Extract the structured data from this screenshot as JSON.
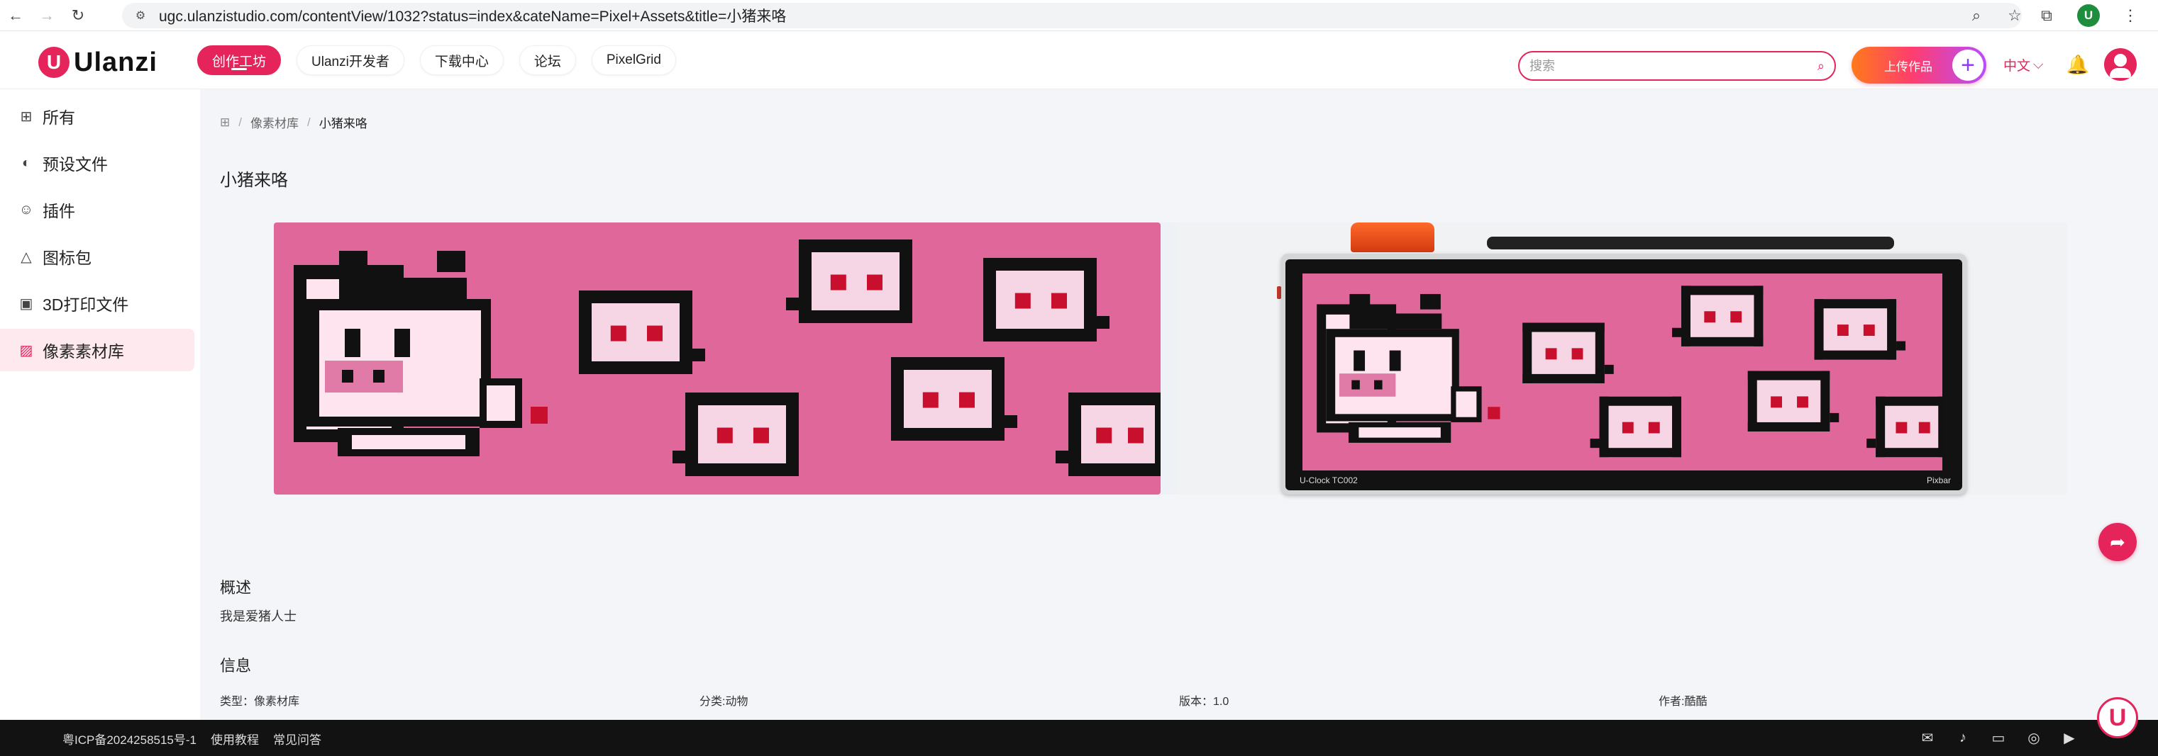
{
  "browser": {
    "url": "ugc.ulanzistudio.com/contentView/1032?status=index&cateName=Pixel+Assets&title=小猪来咯",
    "profile_initial": "U"
  },
  "header": {
    "logo_text": "Ulanzi",
    "nav": [
      "创作工坊",
      "Ulanzi开发者",
      "下载中心",
      "论坛",
      "PixelGrid"
    ],
    "active_nav": "创作工坊",
    "search_placeholder": "搜索",
    "upload_label": "上传作品",
    "upload_plus": "+",
    "language": "中文"
  },
  "sidebar": {
    "items": [
      {
        "label": "所有",
        "icon": "grid-icon"
      },
      {
        "label": "预设文件",
        "icon": "preset-icon"
      },
      {
        "label": "插件",
        "icon": "plugin-icon"
      },
      {
        "label": "图标包",
        "icon": "icon-pack-icon"
      },
      {
        "label": "3D打印文件",
        "icon": "print-3d-icon"
      },
      {
        "label": "像素素材库",
        "icon": "image-icon"
      }
    ],
    "active_index": 5
  },
  "breadcrumb": [
    "像素材库",
    "小猪来咯"
  ],
  "title": "小猪来咯",
  "device": {
    "model": "U-Clock TC002",
    "brand": "Pixbar"
  },
  "overview": {
    "heading": "概述",
    "text": "我是爱猪人士"
  },
  "info": {
    "heading": "信息",
    "type": "类型：像素材库",
    "category": "分类:动物",
    "version": "版本：1.0",
    "author": "作者:酷酷"
  },
  "footer": {
    "icp": "粤ICP备2024258515号-1",
    "tutorial": "使用教程",
    "faq": "常见问答",
    "icons": [
      "mail-icon",
      "tiktok-icon",
      "bilibili-icon",
      "wechat-icon",
      "video-icon"
    ]
  },
  "colors": {
    "brand": "#e4245a",
    "pixel_bg": "#e0679a",
    "pixel_eye": "#c8102e"
  }
}
